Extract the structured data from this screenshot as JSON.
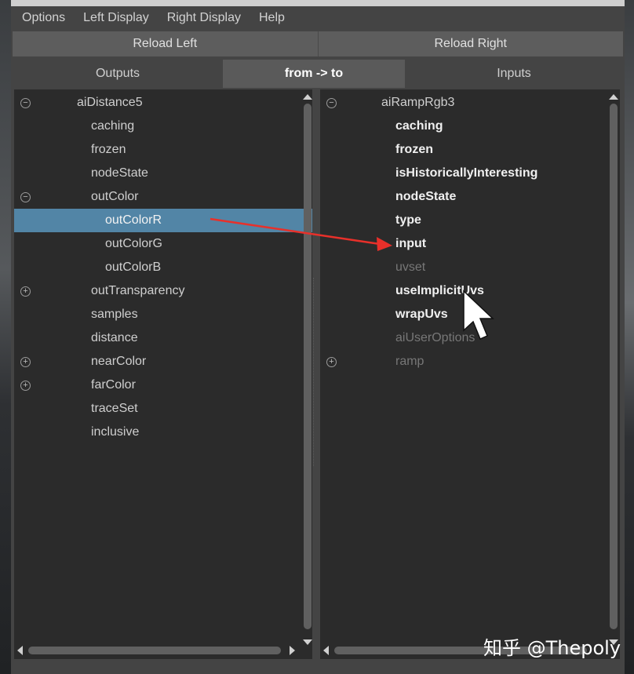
{
  "menu": [
    "Options",
    "Left Display",
    "Right Display",
    "Help"
  ],
  "reload": {
    "left": "Reload Left",
    "right": "Reload Right"
  },
  "tabs": {
    "outputs": "Outputs",
    "direction": "from -> to",
    "inputs": "Inputs"
  },
  "left_panel": {
    "node": "aiDistance5",
    "items": [
      "caching",
      "frozen",
      "nodeState",
      "outColor",
      "outColorR",
      "outColorG",
      "outColorB",
      "outTransparency",
      "samples",
      "distance",
      "nearColor",
      "farColor",
      "traceSet",
      "inclusive"
    ],
    "selected": "outColorR"
  },
  "right_panel": {
    "node": "aiRampRgb3",
    "items": [
      "caching",
      "frozen",
      "isHistoricallyInteresting",
      "nodeState",
      "type",
      "input",
      "uvset",
      "useImplicitUvs",
      "wrapUvs",
      "aiUserOptions",
      "ramp"
    ]
  },
  "watermark": "知乎 @Thepoly",
  "colors": {
    "selection": "#5285a6",
    "arrow": "#e8302a"
  }
}
